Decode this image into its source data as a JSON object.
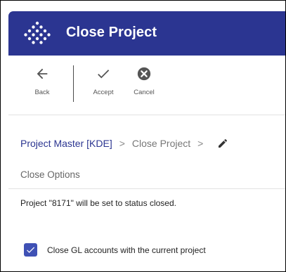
{
  "window": {
    "title": "Close Project"
  },
  "toolbar": {
    "back_label": "Back",
    "accept_label": "Accept",
    "cancel_label": "Cancel"
  },
  "breadcrumb": {
    "parent": "Project Master [KDE]",
    "separator": ">",
    "current": "Close Project",
    "edit_icon": "pencil-icon"
  },
  "section": {
    "title": "Close Options"
  },
  "message": "Project \"8171\" will be set to status closed.",
  "options": {
    "close_gl": {
      "label": "Close GL accounts with the current project",
      "checked": true
    }
  },
  "colors": {
    "title_bar": "#2b3591",
    "link": "#2b3591",
    "checkbox": "#3f51b5"
  }
}
